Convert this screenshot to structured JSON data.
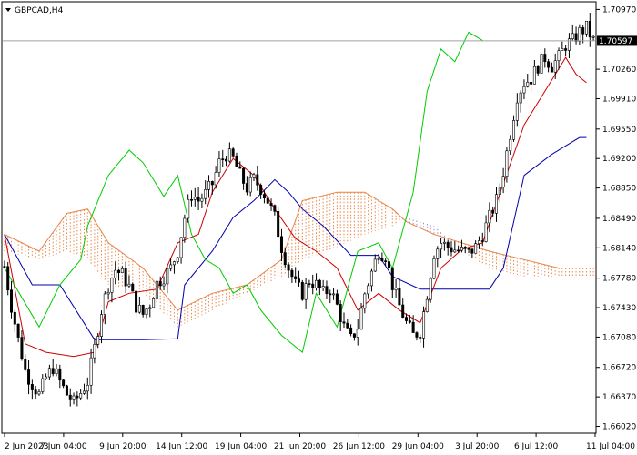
{
  "window": {
    "title": "GBPCAD,H4",
    "current_price": "1.70597"
  },
  "colors": {
    "background": "#ffffff",
    "frame": "#000000",
    "candle": "#000000",
    "tenkan": "#cc0000",
    "kijun": "#0000aa",
    "chikou": "#00cc00",
    "kumo_a": "#e8864a",
    "kumo_b": "#9a8cc4",
    "price_badge_bg": "#000000",
    "price_badge_text": "#ffffff"
  },
  "icons": {
    "menu": "triangle-down-icon"
  },
  "chart_data": {
    "type": "candlestick",
    "symbol": "GBPCAD",
    "timeframe": "H4",
    "ylim": [
      1.6595,
      1.7105
    ],
    "y_ticks": [
      "1.70970",
      "1.70597",
      "1.70260",
      "1.69910",
      "1.69550",
      "1.69200",
      "1.68850",
      "1.68490",
      "1.68140",
      "1.67780",
      "1.67430",
      "1.67080",
      "1.66720",
      "1.66370",
      "1.66020"
    ],
    "x_ticks": [
      "2 Jun 2023",
      "7 Jun 04:00",
      "9 Jun 20:00",
      "14 Jun 12:00",
      "19 Jun 04:00",
      "21 Jun 20:00",
      "26 Jun 12:00",
      "29 Jun 04:00",
      "3 Jul 20:00",
      "6 Jul 12:00",
      "11 Jul 04:00"
    ],
    "anchors": [
      [
        0,
        1.6792
      ],
      [
        2,
        1.6745
      ],
      [
        4,
        1.6705
      ],
      [
        6,
        1.6668
      ],
      [
        8,
        1.6652
      ],
      [
        10,
        1.664
      ],
      [
        12,
        1.666
      ],
      [
        14,
        1.6672
      ],
      [
        16,
        1.6655
      ],
      [
        18,
        1.664
      ],
      [
        20,
        1.663
      ],
      [
        22,
        1.6642
      ],
      [
        24,
        1.6655
      ],
      [
        26,
        1.6695
      ],
      [
        28,
        1.674
      ],
      [
        30,
        1.677
      ],
      [
        32,
        1.6788
      ],
      [
        34,
        1.6782
      ],
      [
        36,
        1.6768
      ],
      [
        38,
        1.6745
      ],
      [
        40,
        1.6735
      ],
      [
        42,
        1.6748
      ],
      [
        44,
        1.6772
      ],
      [
        46,
        1.678
      ],
      [
        48,
        1.679
      ],
      [
        50,
        1.681
      ],
      [
        52,
        1.685
      ],
      [
        54,
        1.6878
      ],
      [
        56,
        1.687
      ],
      [
        58,
        1.6878
      ],
      [
        60,
        1.689
      ],
      [
        62,
        1.6915
      ],
      [
        64,
        1.6925
      ],
      [
        66,
        1.692
      ],
      [
        68,
        1.69
      ],
      [
        70,
        1.6885
      ],
      [
        72,
        1.6895
      ],
      [
        74,
        1.6885
      ],
      [
        76,
        1.687
      ],
      [
        78,
        1.685
      ],
      [
        80,
        1.6815
      ],
      [
        82,
        1.679
      ],
      [
        84,
        1.677
      ],
      [
        86,
        1.676
      ],
      [
        88,
        1.6775
      ],
      [
        90,
        1.677
      ],
      [
        92,
        1.676
      ],
      [
        94,
        1.6765
      ],
      [
        96,
        1.6745
      ],
      [
        98,
        1.672
      ],
      [
        100,
        1.6705
      ],
      [
        102,
        1.672
      ],
      [
        104,
        1.676
      ],
      [
        106,
        1.6785
      ],
      [
        108,
        1.681
      ],
      [
        110,
        1.6805
      ],
      [
        112,
        1.677
      ],
      [
        114,
        1.6745
      ],
      [
        116,
        1.6725
      ],
      [
        118,
        1.671
      ],
      [
        120,
        1.6715
      ],
      [
        122,
        1.676
      ],
      [
        124,
        1.6808
      ],
      [
        126,
        1.682
      ],
      [
        128,
        1.6815
      ],
      [
        130,
        1.6812
      ],
      [
        132,
        1.681
      ],
      [
        134,
        1.6808
      ],
      [
        136,
        1.6815
      ],
      [
        138,
        1.683
      ],
      [
        140,
        1.685
      ],
      [
        142,
        1.687
      ],
      [
        144,
        1.6905
      ],
      [
        146,
        1.695
      ],
      [
        148,
        1.6995
      ],
      [
        150,
        1.701
      ],
      [
        152,
        1.7015
      ],
      [
        154,
        1.703
      ],
      [
        156,
        1.704
      ],
      [
        158,
        1.703
      ],
      [
        160,
        1.704
      ],
      [
        162,
        1.7055
      ],
      [
        164,
        1.706
      ],
      [
        166,
        1.707
      ],
      [
        168,
        1.7075
      ],
      [
        170,
        1.706
      ]
    ],
    "candle_count": 171,
    "tenkan_sen": [
      [
        0,
        1.683
      ],
      [
        6,
        1.67
      ],
      [
        12,
        1.669
      ],
      [
        20,
        1.6685
      ],
      [
        26,
        1.669
      ],
      [
        30,
        1.675
      ],
      [
        36,
        1.676
      ],
      [
        44,
        1.6765
      ],
      [
        50,
        1.682
      ],
      [
        56,
        1.683
      ],
      [
        60,
        1.688
      ],
      [
        66,
        1.692
      ],
      [
        72,
        1.69
      ],
      [
        78,
        1.686
      ],
      [
        84,
        1.6825
      ],
      [
        90,
        1.681
      ],
      [
        96,
        1.679
      ],
      [
        102,
        1.674
      ],
      [
        108,
        1.676
      ],
      [
        114,
        1.674
      ],
      [
        120,
        1.6725
      ],
      [
        126,
        1.679
      ],
      [
        132,
        1.6812
      ],
      [
        138,
        1.682
      ],
      [
        144,
        1.689
      ],
      [
        150,
        1.696
      ],
      [
        156,
        1.7
      ],
      [
        162,
        1.704
      ],
      [
        165,
        1.702
      ],
      [
        168,
        1.701
      ]
    ],
    "kijun_sen": [
      [
        0,
        1.683
      ],
      [
        8,
        1.677
      ],
      [
        16,
        1.677
      ],
      [
        26,
        1.6705
      ],
      [
        40,
        1.6705
      ],
      [
        50,
        1.6706
      ],
      [
        52,
        1.677
      ],
      [
        60,
        1.681
      ],
      [
        66,
        1.685
      ],
      [
        72,
        1.687
      ],
      [
        78,
        1.6895
      ],
      [
        82,
        1.688
      ],
      [
        86,
        1.686
      ],
      [
        92,
        1.684
      ],
      [
        100,
        1.6805
      ],
      [
        108,
        1.6805
      ],
      [
        112,
        1.678
      ],
      [
        120,
        1.6765
      ],
      [
        130,
        1.6765
      ],
      [
        140,
        1.6765
      ],
      [
        144,
        1.679
      ],
      [
        150,
        1.69
      ],
      [
        158,
        1.6925
      ],
      [
        162,
        1.6935
      ],
      [
        166,
        1.6945
      ],
      [
        168,
        1.6945
      ]
    ],
    "chikou_span": [
      [
        0,
        1.679
      ],
      [
        10,
        1.672
      ],
      [
        16,
        1.677
      ],
      [
        22,
        1.68
      ],
      [
        24,
        1.684
      ],
      [
        30,
        1.69
      ],
      [
        36,
        1.693
      ],
      [
        40,
        1.6915
      ],
      [
        46,
        1.6875
      ],
      [
        50,
        1.69
      ],
      [
        54,
        1.683
      ],
      [
        58,
        1.68
      ],
      [
        62,
        1.679
      ],
      [
        66,
        1.676
      ],
      [
        70,
        1.677
      ],
      [
        74,
        1.674
      ],
      [
        80,
        1.671
      ],
      [
        86,
        1.669
      ],
      [
        90,
        1.676
      ],
      [
        96,
        1.672
      ],
      [
        102,
        1.681
      ],
      [
        108,
        1.682
      ],
      [
        112,
        1.679
      ],
      [
        118,
        1.688
      ],
      [
        122,
        1.7
      ],
      [
        126,
        1.705
      ],
      [
        130,
        1.7035
      ],
      [
        134,
        1.707
      ],
      [
        138,
        1.706
      ]
    ],
    "kumo_span_a": [
      [
        0,
        1.683
      ],
      [
        10,
        1.681
      ],
      [
        18,
        1.6855
      ],
      [
        24,
        1.686
      ],
      [
        30,
        1.682
      ],
      [
        40,
        1.679
      ],
      [
        50,
        1.674
      ],
      [
        60,
        1.676
      ],
      [
        70,
        1.677
      ],
      [
        80,
        1.68
      ],
      [
        86,
        1.687
      ],
      [
        96,
        1.688
      ],
      [
        104,
        1.688
      ],
      [
        112,
        1.686
      ],
      [
        116,
        1.6845
      ],
      [
        124,
        1.683
      ],
      [
        132,
        1.682
      ],
      [
        140,
        1.681
      ],
      [
        150,
        1.68
      ],
      [
        160,
        1.679
      ],
      [
        170,
        1.679
      ]
    ],
    "kumo_span_b": [
      [
        0,
        1.681
      ],
      [
        10,
        1.68
      ],
      [
        18,
        1.681
      ],
      [
        24,
        1.68
      ],
      [
        30,
        1.677
      ],
      [
        40,
        1.676
      ],
      [
        50,
        1.672
      ],
      [
        60,
        1.674
      ],
      [
        70,
        1.676
      ],
      [
        80,
        1.678
      ],
      [
        86,
        1.68
      ],
      [
        96,
        1.6815
      ],
      [
        104,
        1.683
      ],
      [
        112,
        1.684
      ],
      [
        116,
        1.685
      ],
      [
        124,
        1.684
      ],
      [
        132,
        1.681
      ],
      [
        140,
        1.679
      ],
      [
        150,
        1.678
      ],
      [
        160,
        1.678
      ],
      [
        170,
        1.678
      ]
    ]
  }
}
